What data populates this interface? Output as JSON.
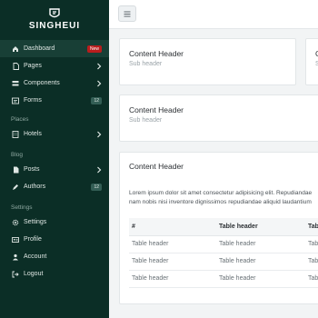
{
  "brand": {
    "name": "SINGHEUI"
  },
  "sidebar": {
    "items": [
      {
        "label": "Dashboard",
        "icon": "home-icon",
        "badge": "New"
      },
      {
        "label": "Pages",
        "icon": "file-icon"
      },
      {
        "label": "Components",
        "icon": "components-icon"
      },
      {
        "label": "Forms",
        "icon": "form-icon",
        "count": "12"
      }
    ],
    "places_label": "Places",
    "places": [
      {
        "label": "Hotels",
        "icon": "building-icon"
      }
    ],
    "blog_label": "Blog",
    "blog": [
      {
        "label": "Posts",
        "icon": "document-icon"
      },
      {
        "label": "Authors",
        "icon": "pen-icon",
        "count": "12"
      }
    ],
    "settings_label": "Settings",
    "settings": [
      {
        "label": "Settings",
        "icon": "gear-icon"
      },
      {
        "label": "Profile",
        "icon": "id-card-icon"
      },
      {
        "label": "Account",
        "icon": "user-icon"
      },
      {
        "label": "Logout",
        "icon": "logout-icon"
      }
    ]
  },
  "cards": {
    "card1": {
      "title": "Content Header",
      "subtitle": "Sub header"
    },
    "card1_partial": {
      "title": "C",
      "subtitle": "S"
    },
    "card2": {
      "title": "Content Header",
      "subtitle": "Sub header"
    },
    "card3": {
      "title": "Content Header",
      "line1": "Lorem ipsum dolor sit amet consectetur adipisicing elit. Repudiandae",
      "line2": "nam nobis nisi inventore dignissimos repudiandae aliquid laudantium"
    }
  },
  "table": {
    "headers": [
      "#",
      "Table header",
      "Table header"
    ],
    "rows": [
      [
        "Table header",
        "Table header",
        "Table header"
      ],
      [
        "Table header",
        "Table header",
        "Table header"
      ],
      [
        "Table header",
        "Table header",
        "Table header"
      ]
    ]
  },
  "colors": {
    "sidebar_bg": "#0b2e26",
    "active_bg": "#183f36",
    "badge_red": "#b91d1d"
  }
}
